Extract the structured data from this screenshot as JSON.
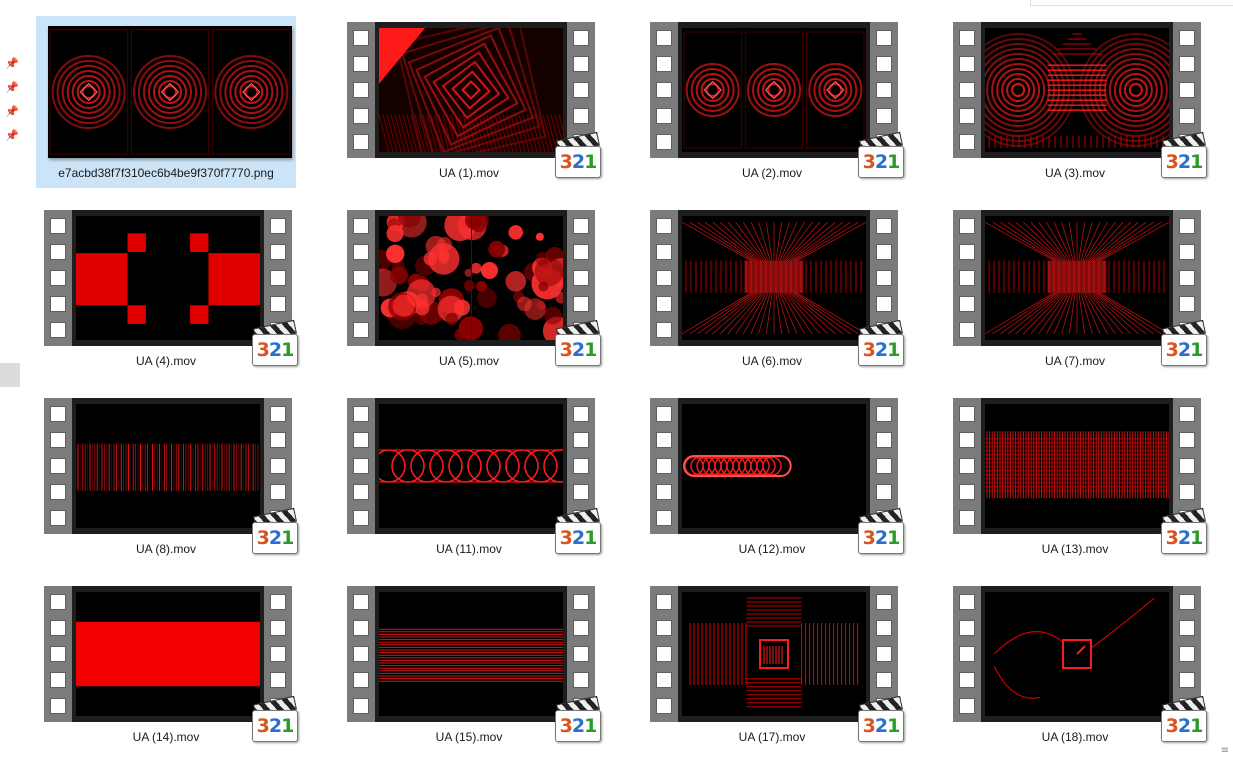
{
  "files": [
    {
      "name": "e7acbd38f7f310ec6b4be9f370f7770.png",
      "kind": "image",
      "selected": true,
      "preview": "rings"
    },
    {
      "name": "UA (1).mov",
      "kind": "video",
      "preview": "tunnel"
    },
    {
      "name": "UA (2).mov",
      "kind": "video",
      "preview": "rings"
    },
    {
      "name": "UA (3).mov",
      "kind": "video",
      "preview": "rings-bars"
    },
    {
      "name": "UA (4).mov",
      "kind": "video",
      "preview": "blocks"
    },
    {
      "name": "UA (5).mov",
      "kind": "video",
      "preview": "noise"
    },
    {
      "name": "UA (6).mov",
      "kind": "video",
      "preview": "corridor"
    },
    {
      "name": "UA (7).mov",
      "kind": "video",
      "preview": "corridor"
    },
    {
      "name": "UA (8).mov",
      "kind": "video",
      "preview": "vlines"
    },
    {
      "name": "UA (11).mov",
      "kind": "video",
      "preview": "circles"
    },
    {
      "name": "UA (12).mov",
      "kind": "video",
      "preview": "pill"
    },
    {
      "name": "UA (13).mov",
      "kind": "video",
      "preview": "band"
    },
    {
      "name": "UA (14).mov",
      "kind": "video",
      "preview": "solid"
    },
    {
      "name": "UA (15).mov",
      "kind": "video",
      "preview": "hlines"
    },
    {
      "name": "UA (17).mov",
      "kind": "video",
      "preview": "cross"
    },
    {
      "name": "UA (18).mov",
      "kind": "video",
      "preview": "clock"
    }
  ],
  "badge": {
    "digit_a": "3",
    "digit_b": "2",
    "digit_c": "1"
  },
  "colors": {
    "accent_red": "#ff1a1a",
    "selection": "#cce4f7"
  },
  "icons": {
    "pin": "pin-icon",
    "badge": "media-player-classic-icon",
    "view": "details-view-icon"
  }
}
